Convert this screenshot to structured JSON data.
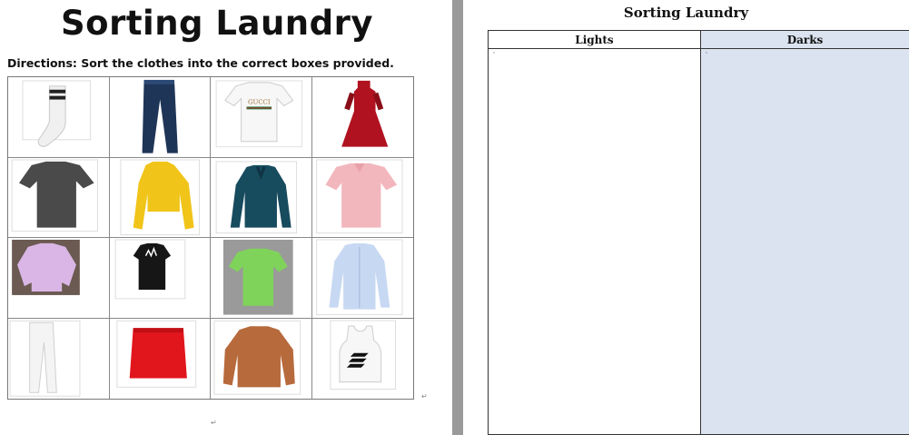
{
  "worksheet": {
    "title": "Sorting Laundry",
    "directions": "Directions: Sort the clothes into the correct boxes provided.",
    "items": [
      {
        "name": "striped-sock-icon",
        "color": "#f2f2f2"
      },
      {
        "name": "blue-jeans-icon",
        "color": "#1f3557"
      },
      {
        "name": "white-graphic-tee-icon",
        "color": "#f7f7f7",
        "print": "GUCCI"
      },
      {
        "name": "red-dress-icon",
        "color": "#b01220"
      },
      {
        "name": "dark-gray-tshirt-icon",
        "color": "#4a4a4a"
      },
      {
        "name": "yellow-hoodie-icon",
        "color": "#f0c419"
      },
      {
        "name": "teal-blouse-icon",
        "color": "#174b5e"
      },
      {
        "name": "pink-polo-icon",
        "color": "#f2b7bd"
      },
      {
        "name": "lavender-jacket-icon",
        "color": "#d9b6e6"
      },
      {
        "name": "black-tshirt-dress-icon",
        "color": "#161616"
      },
      {
        "name": "green-tshirt-icon",
        "color": "#7fd35a"
      },
      {
        "name": "light-blue-shirt-icon",
        "color": "#c7d8f2"
      },
      {
        "name": "white-pants-icon",
        "color": "#f4f4f4"
      },
      {
        "name": "red-skirt-icon",
        "color": "#e1161d"
      },
      {
        "name": "orange-sweater-icon",
        "color": "#b76a3c"
      },
      {
        "name": "white-tank-top-icon",
        "color": "#f7f7f7"
      }
    ]
  },
  "sorting_table": {
    "title": "Sorting Laundry",
    "columns": [
      "Lights",
      "Darks"
    ],
    "dark_column_color": "#dae3ef"
  },
  "marks": {
    "return": "↵",
    "enter": "↵"
  }
}
